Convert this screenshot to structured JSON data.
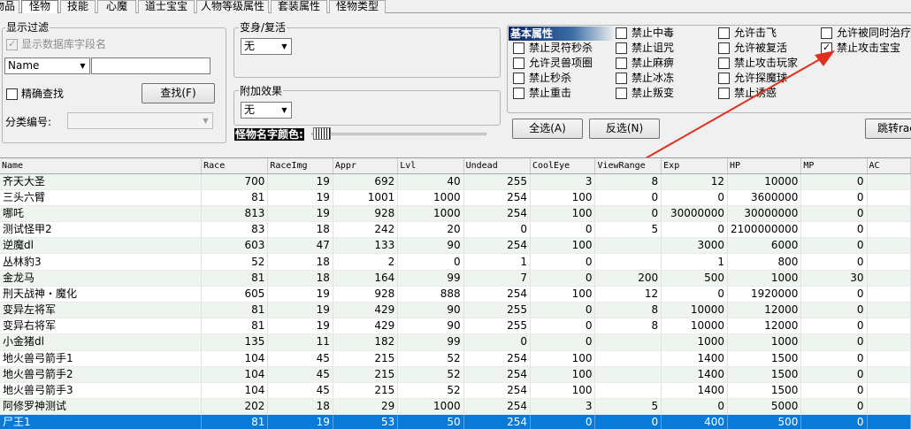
{
  "tabs": [
    "物品",
    "怪物",
    "技能",
    "心魔",
    "道士宝宝",
    "人物等级属性",
    "套装属性",
    "怪物类型"
  ],
  "active_tab": 1,
  "filter": {
    "title": "显示过滤",
    "show_field_names": "显示数据库字段名",
    "field_combo": "Name",
    "field_input": "",
    "exact_search": "精确查找",
    "find_button": "查找(F)",
    "category_label": "分类编号:",
    "category_value": ""
  },
  "transform": {
    "title": "变身/复活",
    "value": "无"
  },
  "effect": {
    "title": "附加效果",
    "value": "无"
  },
  "name_color_label": "怪物名字颜色:",
  "basic_props": {
    "header": "基本属性",
    "col1": [
      "禁止灵符秒杀",
      "允许灵兽项圈",
      "禁止秒杀",
      "禁止重击"
    ],
    "col2": [
      "禁止中毒",
      "禁止诅咒",
      "禁止麻痹",
      "禁止冰冻",
      "禁止叛变"
    ],
    "col3": [
      "允许击飞",
      "允许被复活",
      "禁止攻击玩家",
      "允许探魔球",
      "禁止诱惑"
    ],
    "col4": [
      "允许被同时治疗",
      "禁止攻击宝宝"
    ],
    "checked_col4": [
      false,
      true
    ]
  },
  "buttons": {
    "select_all": "全选(A)",
    "invert": "反选(N)",
    "jump": "跳转rac"
  },
  "grid": {
    "columns": [
      "Name",
      "Race",
      "RaceImg",
      "Appr",
      "Lvl",
      "Undead",
      "CoolEye",
      "ViewRange",
      "Exp",
      "HP",
      "MP",
      "AC"
    ],
    "rows": [
      [
        "齐天大圣",
        "700",
        "19",
        "692",
        "40",
        "255",
        "3",
        "8",
        "12",
        "10000",
        "0",
        ""
      ],
      [
        "三头六臂",
        "81",
        "19",
        "1001",
        "1000",
        "254",
        "100",
        "0",
        "0",
        "3600000",
        "0",
        ""
      ],
      [
        "哪吒",
        "813",
        "19",
        "928",
        "1000",
        "254",
        "100",
        "0",
        "30000000",
        "30000000",
        "0",
        ""
      ],
      [
        "测试怪甲2",
        "83",
        "18",
        "242",
        "20",
        "0",
        "0",
        "5",
        "0",
        "2100000000",
        "0",
        ""
      ],
      [
        "逆魔dl",
        "603",
        "47",
        "133",
        "90",
        "254",
        "100",
        "",
        "3000",
        "6000",
        "0",
        ""
      ],
      [
        "丛林豹3",
        "52",
        "18",
        "2",
        "0",
        "1",
        "0",
        "",
        "1",
        "800",
        "0",
        ""
      ],
      [
        "金龙马",
        "81",
        "18",
        "164",
        "99",
        "7",
        "0",
        "200",
        "500",
        "1000",
        "30",
        ""
      ],
      [
        "刑天战神・魔化",
        "605",
        "19",
        "928",
        "888",
        "254",
        "100",
        "12",
        "0",
        "1920000",
        "0",
        ""
      ],
      [
        "变异左将军",
        "81",
        "19",
        "429",
        "90",
        "255",
        "0",
        "8",
        "10000",
        "12000",
        "0",
        ""
      ],
      [
        "变异右将军",
        "81",
        "19",
        "429",
        "90",
        "255",
        "0",
        "8",
        "10000",
        "12000",
        "0",
        ""
      ],
      [
        "小金猪dl",
        "135",
        "11",
        "182",
        "99",
        "0",
        "0",
        "",
        "1000",
        "1000",
        "0",
        ""
      ],
      [
        "地火兽弓箭手1",
        "104",
        "45",
        "215",
        "52",
        "254",
        "100",
        "",
        "1400",
        "1500",
        "0",
        ""
      ],
      [
        "地火兽弓箭手2",
        "104",
        "45",
        "215",
        "52",
        "254",
        "100",
        "",
        "1400",
        "1500",
        "0",
        ""
      ],
      [
        "地火兽弓箭手3",
        "104",
        "45",
        "215",
        "52",
        "254",
        "100",
        "",
        "1400",
        "1500",
        "0",
        ""
      ],
      [
        "阿修罗神测试",
        "202",
        "18",
        "29",
        "1000",
        "254",
        "3",
        "5",
        "0",
        "5000",
        "0",
        ""
      ],
      [
        "尸王1",
        "81",
        "19",
        "53",
        "50",
        "254",
        "0",
        "0",
        "400",
        "500",
        "0",
        ""
      ]
    ],
    "selected_row": 15
  }
}
